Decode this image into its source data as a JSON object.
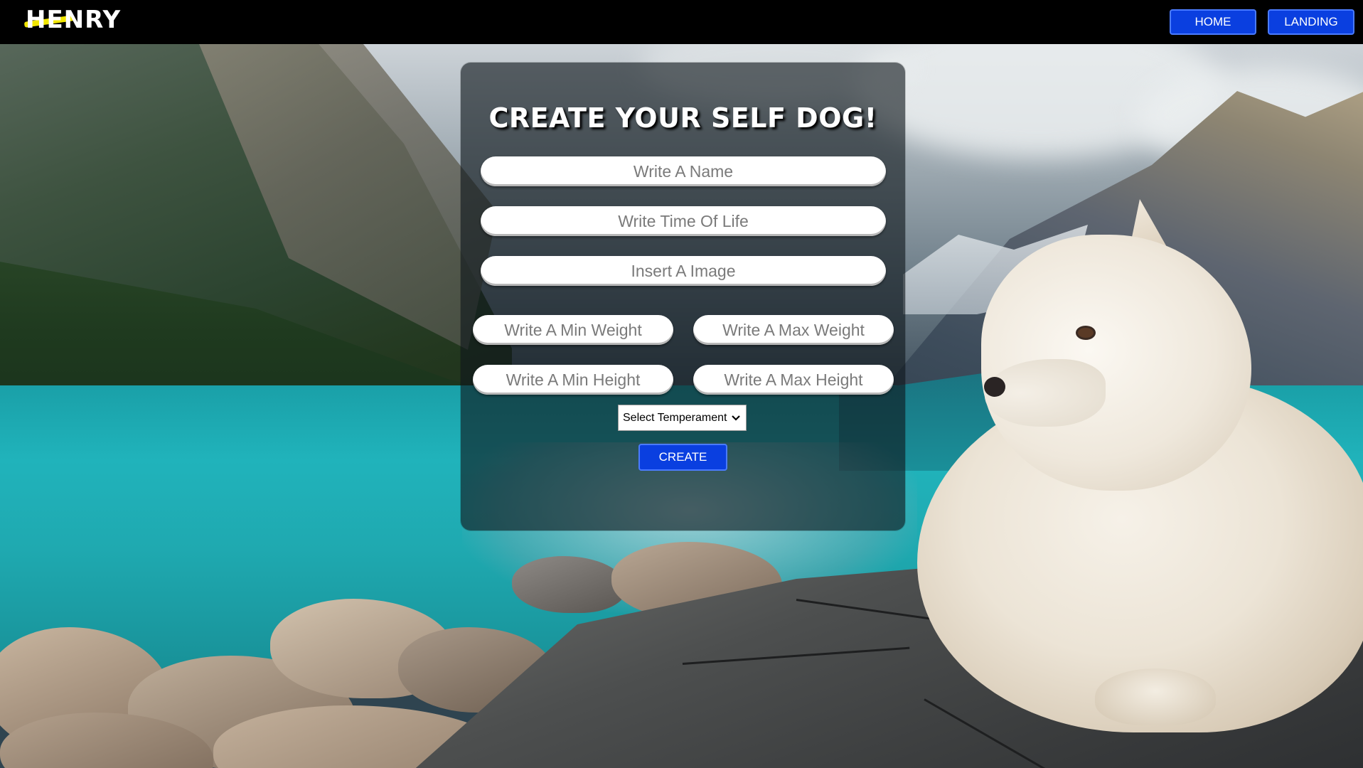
{
  "brand": {
    "logo_text": "HENRY"
  },
  "nav": {
    "home_label": "HOME",
    "landing_label": "LANDING"
  },
  "form": {
    "title": "CREATE YOUR SELF DOG!",
    "name_placeholder": "Write A Name",
    "life_placeholder": "Write Time Of Life",
    "image_placeholder": "Insert A Image",
    "min_weight_placeholder": "Write A Min Weight",
    "max_weight_placeholder": "Write A Max Weight",
    "min_height_placeholder": "Write A Min Height",
    "max_height_placeholder": "Write A Max Height",
    "temperament_label": "Select Temperament",
    "create_label": "CREATE"
  },
  "icons": {
    "dropdown": "chevron-down-icon"
  },
  "colors": {
    "button_bg": "#0a3fe0",
    "navbar_bg": "#000000",
    "logo_accent": "#f1e600"
  }
}
